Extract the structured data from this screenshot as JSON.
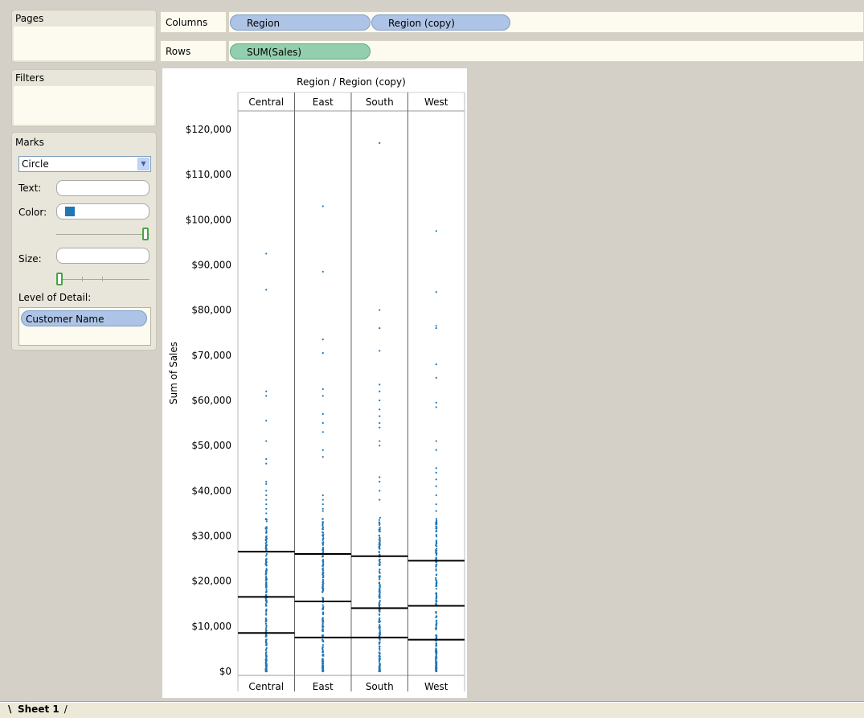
{
  "shelves": {
    "pages": {
      "title": "Pages"
    },
    "filters": {
      "title": "Filters"
    },
    "columns": {
      "label": "Columns",
      "pills": [
        "Region",
        "Region (copy)"
      ]
    },
    "rows": {
      "label": "Rows",
      "pills": [
        "SUM(Sales)"
      ]
    }
  },
  "marks": {
    "title": "Marks",
    "mark_type": "Circle",
    "text_label": "Text:",
    "color_label": "Color:",
    "color_swatch": "#1f77b4",
    "size_label": "Size:",
    "lod_label": "Level of Detail:",
    "lod_pill": "Customer Name",
    "opacity_slider": 1.0,
    "size_slider": 0.0
  },
  "sheet_tab": "Sheet 1",
  "chart_data": {
    "type": "scatter",
    "title": "Region / Region (copy)",
    "ylabel": "Sum of Sales",
    "categories": [
      "Central",
      "East",
      "South",
      "West"
    ],
    "ylim": [
      0,
      120000
    ],
    "yticks": [
      "$0",
      "$10,000",
      "$20,000",
      "$30,000",
      "$40,000",
      "$50,000",
      "$60,000",
      "$70,000",
      "$80,000",
      "$90,000",
      "$100,000",
      "$110,000",
      "$120,000"
    ],
    "point_color": "#1f77b4",
    "reference_lines": {
      "Central": [
        8500,
        16500,
        26500
      ],
      "East": [
        7500,
        15500,
        26000
      ],
      "South": [
        7500,
        14000,
        25500
      ],
      "West": [
        7000,
        14500,
        24500
      ]
    },
    "outliers": {
      "Central": [
        92500,
        84500,
        62000,
        61000,
        55500,
        51000,
        47000,
        46000,
        42000,
        41500,
        40000,
        39000,
        38000,
        37000,
        36000,
        35000
      ],
      "East": [
        103000,
        88500,
        73500,
        70500,
        62500,
        61000,
        57000,
        55000,
        53000,
        49000,
        47500,
        39000,
        38000,
        37000,
        36000,
        35500
      ],
      "South": [
        117000,
        80000,
        76000,
        71000,
        63500,
        62000,
        60000,
        58000,
        56500,
        55000,
        54000,
        51000,
        50000,
        43000,
        42000,
        40000,
        38000
      ],
      "West": [
        97500,
        84000,
        76500,
        76000,
        68000,
        65000,
        59500,
        58500,
        51000,
        49000,
        45000,
        44000,
        42500,
        41000,
        39000,
        37000,
        35500
      ]
    }
  }
}
